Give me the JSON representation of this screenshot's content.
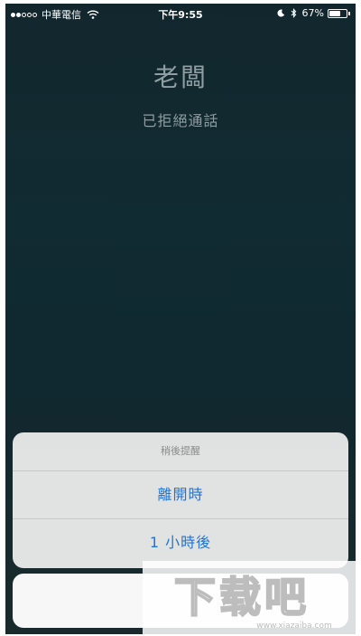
{
  "status_bar": {
    "carrier": "中華電信",
    "time": "下午9:55",
    "battery": "67%",
    "battery_level": 0.67,
    "signal_full": 2,
    "signal_empty": 3
  },
  "caller": {
    "name": "老闆",
    "status": "已拒絕通話"
  },
  "action_sheet": {
    "title": "稍後提醒",
    "options": [
      {
        "label": "離開時"
      },
      {
        "label": "1 小時後"
      }
    ]
  },
  "watermark": {
    "logo_text": "下载吧",
    "url": "www.xiazaiba.com"
  },
  "colors": {
    "accent": "#1f74d6",
    "background": "#112b33",
    "text_muted": "#8f9ea2"
  }
}
